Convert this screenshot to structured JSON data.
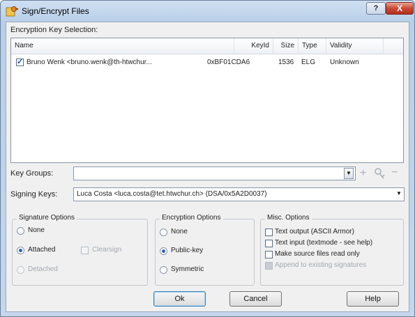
{
  "window": {
    "title": "Sign/Encrypt Files",
    "help_label": "?",
    "close_label": "X"
  },
  "encryption": {
    "section_label": "Encryption Key Selection:",
    "columns": {
      "name": "Name",
      "keyid": "KeyId",
      "size": "Size",
      "type": "Type",
      "validity": "Validity"
    },
    "rows": [
      {
        "checked": true,
        "name": "Bruno Wenk <bruno.wenk@th-htwchur...",
        "keyid": "0xBF01CDA6",
        "size": "1536",
        "type": "ELG",
        "validity": "Unknown"
      }
    ]
  },
  "key_groups": {
    "label": "Key Groups:",
    "value": "",
    "add_icon": "plus-icon",
    "edit_icon": "key-icon",
    "remove_icon": "minus-icon"
  },
  "signing": {
    "label": "Signing Keys:",
    "value": "Luca Costa <luca.costa@tet.htwchur.ch> (DSA/0x5A2D0037)"
  },
  "signature_options": {
    "title": "Signature Options",
    "none": "None",
    "attached": "Attached",
    "clearsign": "Clearsign",
    "detached": "Detached",
    "selected": "Attached"
  },
  "encryption_options": {
    "title": "Encryption Options",
    "none": "None",
    "public_key": "Public-key",
    "symmetric": "Symmetric",
    "selected": "Public-key"
  },
  "misc_options": {
    "title": "Misc. Options",
    "text_output": "Text output (ASCII Armor)",
    "text_input": "Text input (textmode - see help)",
    "read_only": "Make source files read only",
    "append": "Append to existing signatures"
  },
  "buttons": {
    "ok": "Ok",
    "cancel": "Cancel",
    "help": "Help"
  },
  "colors": {
    "accent": "#2f5fb8",
    "title_bar": "#c4d7ec",
    "close": "#c94a35"
  }
}
